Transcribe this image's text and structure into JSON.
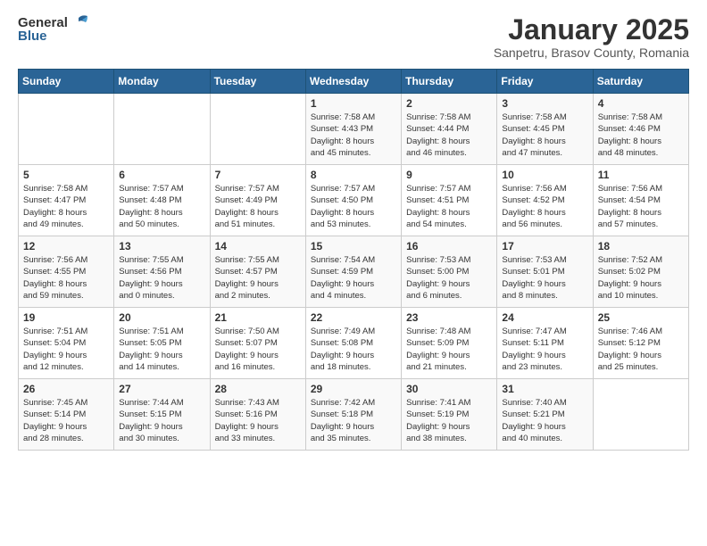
{
  "logo": {
    "general": "General",
    "blue": "Blue"
  },
  "title": "January 2025",
  "location": "Sanpetru, Brasov County, Romania",
  "days_header": [
    "Sunday",
    "Monday",
    "Tuesday",
    "Wednesday",
    "Thursday",
    "Friday",
    "Saturday"
  ],
  "weeks": [
    [
      {
        "day": "",
        "info": ""
      },
      {
        "day": "",
        "info": ""
      },
      {
        "day": "",
        "info": ""
      },
      {
        "day": "1",
        "info": "Sunrise: 7:58 AM\nSunset: 4:43 PM\nDaylight: 8 hours\nand 45 minutes."
      },
      {
        "day": "2",
        "info": "Sunrise: 7:58 AM\nSunset: 4:44 PM\nDaylight: 8 hours\nand 46 minutes."
      },
      {
        "day": "3",
        "info": "Sunrise: 7:58 AM\nSunset: 4:45 PM\nDaylight: 8 hours\nand 47 minutes."
      },
      {
        "day": "4",
        "info": "Sunrise: 7:58 AM\nSunset: 4:46 PM\nDaylight: 8 hours\nand 48 minutes."
      }
    ],
    [
      {
        "day": "5",
        "info": "Sunrise: 7:58 AM\nSunset: 4:47 PM\nDaylight: 8 hours\nand 49 minutes."
      },
      {
        "day": "6",
        "info": "Sunrise: 7:57 AM\nSunset: 4:48 PM\nDaylight: 8 hours\nand 50 minutes."
      },
      {
        "day": "7",
        "info": "Sunrise: 7:57 AM\nSunset: 4:49 PM\nDaylight: 8 hours\nand 51 minutes."
      },
      {
        "day": "8",
        "info": "Sunrise: 7:57 AM\nSunset: 4:50 PM\nDaylight: 8 hours\nand 53 minutes."
      },
      {
        "day": "9",
        "info": "Sunrise: 7:57 AM\nSunset: 4:51 PM\nDaylight: 8 hours\nand 54 minutes."
      },
      {
        "day": "10",
        "info": "Sunrise: 7:56 AM\nSunset: 4:52 PM\nDaylight: 8 hours\nand 56 minutes."
      },
      {
        "day": "11",
        "info": "Sunrise: 7:56 AM\nSunset: 4:54 PM\nDaylight: 8 hours\nand 57 minutes."
      }
    ],
    [
      {
        "day": "12",
        "info": "Sunrise: 7:56 AM\nSunset: 4:55 PM\nDaylight: 8 hours\nand 59 minutes."
      },
      {
        "day": "13",
        "info": "Sunrise: 7:55 AM\nSunset: 4:56 PM\nDaylight: 9 hours\nand 0 minutes."
      },
      {
        "day": "14",
        "info": "Sunrise: 7:55 AM\nSunset: 4:57 PM\nDaylight: 9 hours\nand 2 minutes."
      },
      {
        "day": "15",
        "info": "Sunrise: 7:54 AM\nSunset: 4:59 PM\nDaylight: 9 hours\nand 4 minutes."
      },
      {
        "day": "16",
        "info": "Sunrise: 7:53 AM\nSunset: 5:00 PM\nDaylight: 9 hours\nand 6 minutes."
      },
      {
        "day": "17",
        "info": "Sunrise: 7:53 AM\nSunset: 5:01 PM\nDaylight: 9 hours\nand 8 minutes."
      },
      {
        "day": "18",
        "info": "Sunrise: 7:52 AM\nSunset: 5:02 PM\nDaylight: 9 hours\nand 10 minutes."
      }
    ],
    [
      {
        "day": "19",
        "info": "Sunrise: 7:51 AM\nSunset: 5:04 PM\nDaylight: 9 hours\nand 12 minutes."
      },
      {
        "day": "20",
        "info": "Sunrise: 7:51 AM\nSunset: 5:05 PM\nDaylight: 9 hours\nand 14 minutes."
      },
      {
        "day": "21",
        "info": "Sunrise: 7:50 AM\nSunset: 5:07 PM\nDaylight: 9 hours\nand 16 minutes."
      },
      {
        "day": "22",
        "info": "Sunrise: 7:49 AM\nSunset: 5:08 PM\nDaylight: 9 hours\nand 18 minutes."
      },
      {
        "day": "23",
        "info": "Sunrise: 7:48 AM\nSunset: 5:09 PM\nDaylight: 9 hours\nand 21 minutes."
      },
      {
        "day": "24",
        "info": "Sunrise: 7:47 AM\nSunset: 5:11 PM\nDaylight: 9 hours\nand 23 minutes."
      },
      {
        "day": "25",
        "info": "Sunrise: 7:46 AM\nSunset: 5:12 PM\nDaylight: 9 hours\nand 25 minutes."
      }
    ],
    [
      {
        "day": "26",
        "info": "Sunrise: 7:45 AM\nSunset: 5:14 PM\nDaylight: 9 hours\nand 28 minutes."
      },
      {
        "day": "27",
        "info": "Sunrise: 7:44 AM\nSunset: 5:15 PM\nDaylight: 9 hours\nand 30 minutes."
      },
      {
        "day": "28",
        "info": "Sunrise: 7:43 AM\nSunset: 5:16 PM\nDaylight: 9 hours\nand 33 minutes."
      },
      {
        "day": "29",
        "info": "Sunrise: 7:42 AM\nSunset: 5:18 PM\nDaylight: 9 hours\nand 35 minutes."
      },
      {
        "day": "30",
        "info": "Sunrise: 7:41 AM\nSunset: 5:19 PM\nDaylight: 9 hours\nand 38 minutes."
      },
      {
        "day": "31",
        "info": "Sunrise: 7:40 AM\nSunset: 5:21 PM\nDaylight: 9 hours\nand 40 minutes."
      },
      {
        "day": "",
        "info": ""
      }
    ]
  ]
}
